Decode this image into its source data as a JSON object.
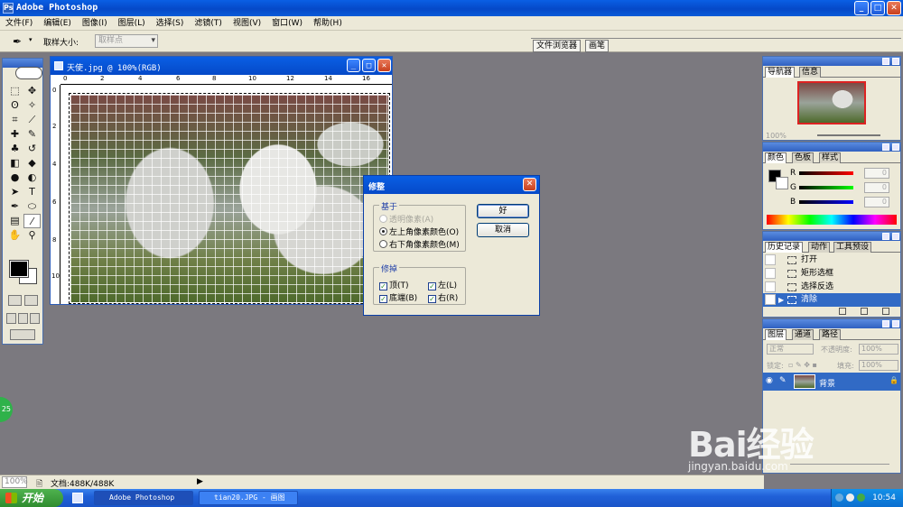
{
  "app": {
    "title": "Adobe Photoshop"
  },
  "menu": [
    "文件(F)",
    "编辑(E)",
    "图像(I)",
    "图层(L)",
    "选择(S)",
    "滤镜(T)",
    "视图(V)",
    "窗口(W)",
    "帮助(H)"
  ],
  "options": {
    "sample_size_label": "取样大小:",
    "sample_size_value": "取样点"
  },
  "palette_well": {
    "tab1": "文件浏览器",
    "tab2": "画笔"
  },
  "document": {
    "title": "天使.jpg @ 100%(RGB)",
    "ruler_h": [
      "0",
      "2",
      "4",
      "6",
      "8",
      "10",
      "12",
      "14",
      "16"
    ],
    "ruler_v": [
      "0",
      "2",
      "4",
      "6",
      "8",
      "10"
    ]
  },
  "dialog": {
    "title": "修整",
    "based_on": {
      "label": "基于",
      "opt1": "透明像素(A)",
      "opt2": "左上角像素颜色(O)",
      "opt3": "右下角像素颜色(M)"
    },
    "trim": {
      "label": "修掉",
      "top": "顶(T)",
      "left": "左(L)",
      "bottom": "底端(B)",
      "right": "右(R)"
    },
    "ok": "好",
    "cancel": "取消"
  },
  "navigator": {
    "tab1": "导航器",
    "tab2": "信息",
    "zoom": "100%"
  },
  "color": {
    "tab1": "颜色",
    "tab2": "色板",
    "tab3": "样式",
    "r": "R",
    "g": "G",
    "b": "B",
    "r_val": "0",
    "g_val": "0",
    "b_val": "0"
  },
  "history": {
    "tab1": "历史记录",
    "tab2": "动作",
    "tab3": "工具预设",
    "items": [
      "打开",
      "矩形选框",
      "选择反选",
      "清除"
    ]
  },
  "layers": {
    "tab1": "图层",
    "tab2": "通道",
    "tab3": "路径",
    "blend": "正常",
    "opacity_label": "不透明度:",
    "opacity": "100%",
    "lock_label": "锁定:",
    "fill_label": "填充:",
    "fill": "100%",
    "layer_name": "背景"
  },
  "status": {
    "zoom": "100%",
    "doc": "文档:488K/488K"
  },
  "taskbar": {
    "start": "开始",
    "task1": "Adobe Photoshop",
    "task2": "tian20.JPG - 画图",
    "clock": "10:54"
  },
  "watermark": {
    "brand": "Bai经验",
    "url": "jingyan.baidu.com"
  },
  "bubble": "25",
  "colors": {
    "accent": "#0a5fe4",
    "selection": "#316ac5"
  }
}
